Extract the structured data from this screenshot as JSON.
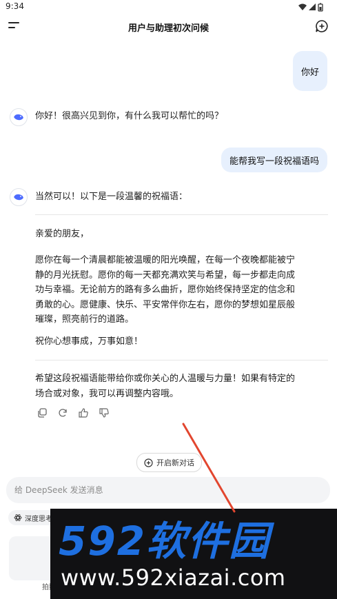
{
  "status": {
    "time": "9:34"
  },
  "header": {
    "title": "用户与助理初次问候"
  },
  "messages": {
    "user_1": "你好",
    "ai_1": "你好！很高兴见到你，有什么我可以帮忙的吗？",
    "user_2": "能帮我写一段祝福语吗",
    "ai_2_intro": "当然可以！以下是一段温馨的祝福语：",
    "ai_2_greeting": "亲爱的朋友，",
    "ai_2_body_l1": "愿你在每一个清晨都能被温暖的阳光唤醒，在每一个夜晚都能被宁",
    "ai_2_body_l2": "静的月光抚慰。愿你的每一天都充满欢笑与希望，每一步都走向成",
    "ai_2_body_l3": "功与幸福。无论前方的路有多么曲折，愿你始终保持坚定的信念和",
    "ai_2_body_l4": "勇敢的心。愿健康、快乐、平安常伴你左右，愿你的梦想如星辰般",
    "ai_2_body_l5": "璀璨，照亮前行的道路。",
    "ai_2_closing": "祝你心想事成，万事如意！",
    "ai_2_outro_l1": "希望这段祝福语能带给你或你关心的人温暖与力量！如果有特定的",
    "ai_2_outro_l2": "场合或对象，我可以再调整内容哦。"
  },
  "actions": [
    "copy-icon",
    "refresh-icon",
    "thumbs-up-icon",
    "thumbs-down-icon"
  ],
  "new_dialog_label": "开启新对话",
  "composer": {
    "placeholder": "给 DeepSeek 发送消息"
  },
  "deepthink_label": "深度思考",
  "photo_label": "拍照",
  "watermark": {
    "line1": "592软件园",
    "line2": "www.592xiazai.com"
  },
  "colors": {
    "accent": "#4d6bfe",
    "user_bubble": "#e7f0fd",
    "watermark_blue": "#1e6fe0",
    "arrow_red": "#e2462f"
  }
}
